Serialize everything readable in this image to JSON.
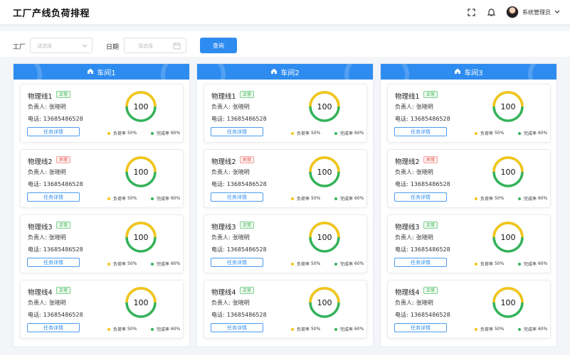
{
  "header": {
    "title": "工厂产线负荷排程",
    "user_name": "系统管理员",
    "icons": [
      "fullscreen-icon",
      "bell-icon",
      "chevron-down-icon"
    ]
  },
  "filters": {
    "factory_label": "工厂",
    "factory_placeholder": "请选择",
    "date_label": "日期",
    "date_placeholder": "请选择",
    "query_label": "查询"
  },
  "colors": {
    "primary": "#2e8cf0",
    "normal": "#2fae4b",
    "abnormal": "#e8413d",
    "gauge_yellow": "#f5c518",
    "gauge_green": "#34b25a"
  },
  "workshops": [
    {
      "name": "车间1",
      "lines": [
        {
          "name": "物理线1",
          "status": "正常",
          "owner_label": "负责人:",
          "owner": "张晓明",
          "phone_label": "电话:",
          "phone": "13685486528",
          "gauge": "100",
          "detail": "任务详情",
          "load_label": "负荷率",
          "load": "50%",
          "done_label": "完成率",
          "done": "60%"
        },
        {
          "name": "物理线2",
          "status": "异常",
          "owner_label": "负责人:",
          "owner": "张晓明",
          "phone_label": "电话:",
          "phone": "13685486528",
          "gauge": "100",
          "detail": "任务详情",
          "load_label": "负荷率",
          "load": "50%",
          "done_label": "完成率",
          "done": "60%"
        },
        {
          "name": "物理线3",
          "status": "正常",
          "owner_label": "负责人:",
          "owner": "张晓明",
          "phone_label": "电话:",
          "phone": "13685486528",
          "gauge": "100",
          "detail": "任务详情",
          "load_label": "负荷率",
          "load": "50%",
          "done_label": "完成率",
          "done": "60%"
        },
        {
          "name": "物理线4",
          "status": "正常",
          "owner_label": "负责人:",
          "owner": "张晓明",
          "phone_label": "电话:",
          "phone": "13685486528",
          "gauge": "100",
          "detail": "任务详情",
          "load_label": "负荷率",
          "load": "50%",
          "done_label": "完成率",
          "done": "60%"
        }
      ]
    },
    {
      "name": "车间2",
      "lines": [
        {
          "name": "物理线1",
          "status": "正常",
          "owner_label": "负责人:",
          "owner": "张晓明",
          "phone_label": "电话:",
          "phone": "13685486528",
          "gauge": "100",
          "detail": "任务详情",
          "load_label": "负荷率",
          "load": "50%",
          "done_label": "完成率",
          "done": "60%"
        },
        {
          "name": "物理线2",
          "status": "异常",
          "owner_label": "负责人:",
          "owner": "张晓明",
          "phone_label": "电话:",
          "phone": "13685486528",
          "gauge": "100",
          "detail": "任务详情",
          "load_label": "负荷率",
          "load": "50%",
          "done_label": "完成率",
          "done": "60%"
        },
        {
          "name": "物理线3",
          "status": "正常",
          "owner_label": "负责人:",
          "owner": "张晓明",
          "phone_label": "电话:",
          "phone": "13685486528",
          "gauge": "100",
          "detail": "任务详情",
          "load_label": "负荷率",
          "load": "50%",
          "done_label": "完成率",
          "done": "60%"
        },
        {
          "name": "物理线4",
          "status": "正常",
          "owner_label": "负责人:",
          "owner": "张晓明",
          "phone_label": "电话:",
          "phone": "13685486528",
          "gauge": "100",
          "detail": "任务详情",
          "load_label": "负荷率",
          "load": "50%",
          "done_label": "完成率",
          "done": "60%"
        }
      ]
    },
    {
      "name": "车间3",
      "lines": [
        {
          "name": "物理线1",
          "status": "正常",
          "owner_label": "负责人:",
          "owner": "张晓明",
          "phone_label": "电话:",
          "phone": "13685486528",
          "gauge": "100",
          "detail": "任务详情",
          "load_label": "负荷率",
          "load": "50%",
          "done_label": "完成率",
          "done": "60%"
        },
        {
          "name": "物理线2",
          "status": "异常",
          "owner_label": "负责人:",
          "owner": "张晓明",
          "phone_label": "电话:",
          "phone": "13685486528",
          "gauge": "100",
          "detail": "任务详情",
          "load_label": "负荷率",
          "load": "50%",
          "done_label": "完成率",
          "done": "60%"
        },
        {
          "name": "物理线3",
          "status": "正常",
          "owner_label": "负责人:",
          "owner": "张晓明",
          "phone_label": "电话:",
          "phone": "13685486528",
          "gauge": "100",
          "detail": "任务详情",
          "load_label": "负荷率",
          "load": "50%",
          "done_label": "完成率",
          "done": "60%"
        },
        {
          "name": "物理线4",
          "status": "正常",
          "owner_label": "负责人:",
          "owner": "张晓明",
          "phone_label": "电话:",
          "phone": "13685486528",
          "gauge": "100",
          "detail": "任务详情",
          "load_label": "负荷率",
          "load": "50%",
          "done_label": "完成率",
          "done": "60%"
        }
      ]
    }
  ]
}
